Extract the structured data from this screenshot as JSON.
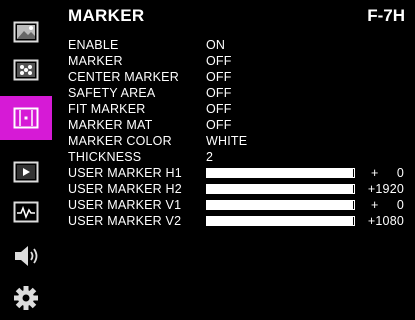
{
  "header": {
    "title": "MARKER",
    "model": "F-7H"
  },
  "sidebar": {
    "items": [
      {
        "icon": "picture-icon",
        "active": false
      },
      {
        "icon": "dots-icon",
        "active": false
      },
      {
        "icon": "marker-icon",
        "active": true
      },
      {
        "icon": "play-icon",
        "active": false
      },
      {
        "icon": "waveform-icon",
        "active": false
      },
      {
        "icon": "speaker-icon",
        "active": false
      },
      {
        "icon": "gear-icon",
        "active": false
      }
    ],
    "active_color": "#d61ad6"
  },
  "settings": [
    {
      "label": "ENABLE",
      "value": "ON"
    },
    {
      "label": "MARKER",
      "value": "OFF"
    },
    {
      "label": "CENTER MARKER",
      "value": "OFF"
    },
    {
      "label": "SAFETY AREA",
      "value": "OFF"
    },
    {
      "label": "FIT MARKER",
      "value": "OFF"
    },
    {
      "label": "MARKER MAT",
      "value": "OFF"
    },
    {
      "label": "MARKER COLOR",
      "value": "WHITE"
    },
    {
      "label": "THICKNESS",
      "value": "2"
    }
  ],
  "user_markers": [
    {
      "label": "USER MARKER H1",
      "value": "+     0",
      "fill": 0.99
    },
    {
      "label": "USER MARKER H2",
      "value": "+1920",
      "fill": 0.99
    },
    {
      "label": "USER MARKER V1",
      "value": "+     0",
      "fill": 0.99
    },
    {
      "label": "USER MARKER V2",
      "value": "+1080",
      "fill": 0.99
    }
  ]
}
